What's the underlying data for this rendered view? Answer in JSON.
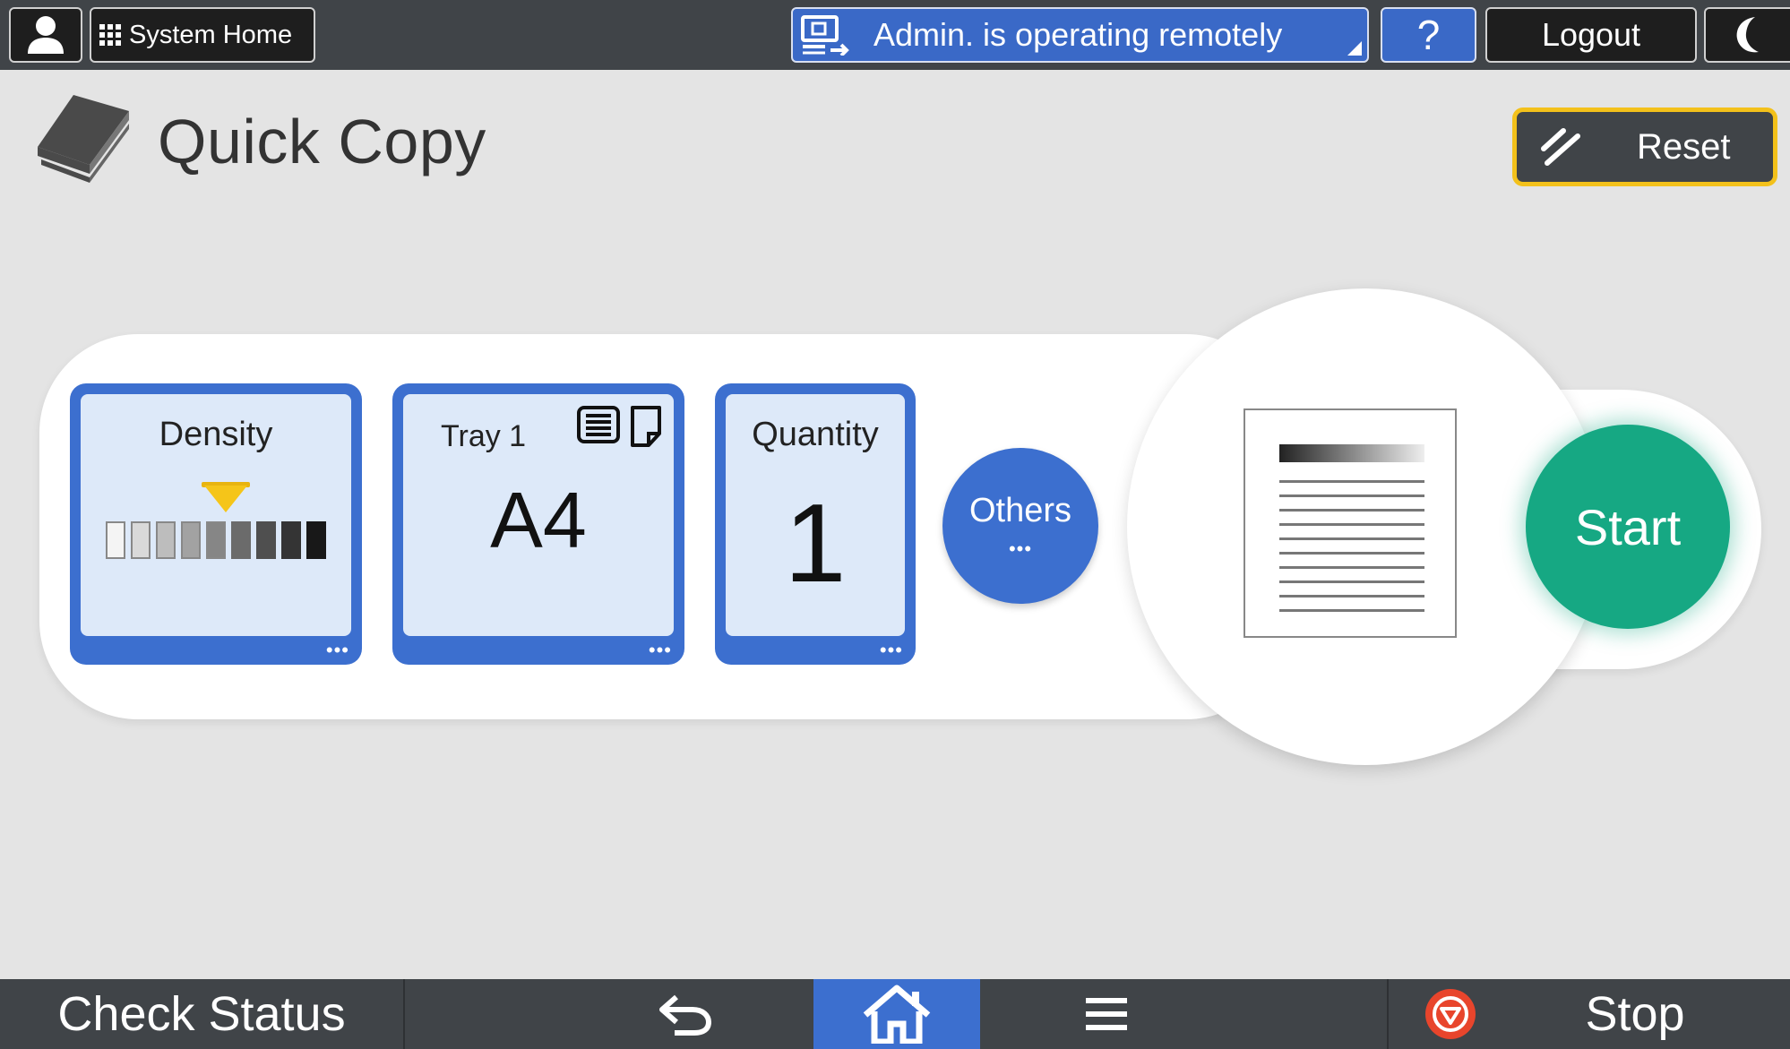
{
  "topbar": {
    "user_icon": "user-icon",
    "system_home_label": "System Home",
    "remote_status": "Admin. is operating remotely",
    "help_label": "?",
    "logout_label": "Logout",
    "sleep_icon": "moon-icon"
  },
  "header": {
    "title": "Quick Copy",
    "reset_label": "Reset"
  },
  "settings": {
    "density": {
      "label": "Density",
      "level": 0.5,
      "steps": 9
    },
    "paper": {
      "tray_label": "Tray 1",
      "size": "A4"
    },
    "quantity": {
      "label": "Quantity",
      "value": "1"
    },
    "others_label": "Others",
    "more_indicator": "•••"
  },
  "start_label": "Start",
  "bottombar": {
    "check_status_label": "Check Status",
    "stop_label": "Stop"
  },
  "colors": {
    "accent_blue": "#3c6fcf",
    "start_green": "#16a883",
    "reset_border": "#f3c11b",
    "bar_bg": "#404448",
    "stop_red": "#e8452c"
  }
}
